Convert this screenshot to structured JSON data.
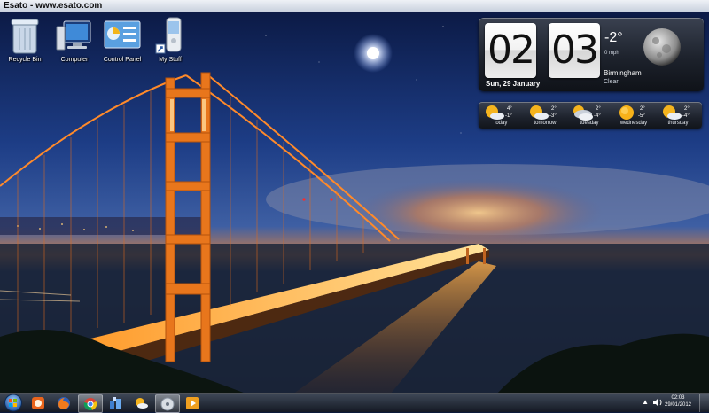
{
  "banner": {
    "text": "Esato - www.esato.com"
  },
  "desktop": {
    "icons": [
      {
        "label": "Recycle Bin",
        "icon": "recycle-bin-icon"
      },
      {
        "label": "Computer",
        "icon": "computer-icon"
      },
      {
        "label": "Control Panel",
        "icon": "control-panel-icon"
      },
      {
        "label": "My Stuff",
        "icon": "phone-shortcut-icon"
      }
    ]
  },
  "clock_gadget": {
    "hour": "02",
    "minute": "03",
    "date": "Sun, 29 January",
    "temperature": "-2°",
    "wind": "0 mph",
    "city": "Birmingham",
    "condition": "Clear"
  },
  "forecast": [
    {
      "day": "today",
      "high": "4°",
      "low": "-1°",
      "icon": "partly-sunny-icon"
    },
    {
      "day": "tomorrow",
      "high": "2°",
      "low": "-3°",
      "icon": "partly-sunny-icon"
    },
    {
      "day": "tuesday",
      "high": "2°",
      "low": "-4°",
      "icon": "cloudy-icon"
    },
    {
      "day": "wednesday",
      "high": "2°",
      "low": "-5°",
      "icon": "sunny-icon"
    },
    {
      "day": "thursday",
      "high": "2°",
      "low": "-4°",
      "icon": "partly-sunny-icon"
    }
  ],
  "taskbar": {
    "pinned": [
      {
        "name": "app-orange-icon"
      },
      {
        "name": "firefox-icon"
      },
      {
        "name": "chrome-icon"
      },
      {
        "name": "network-tool-icon"
      },
      {
        "name": "weather-app-icon"
      },
      {
        "name": "media-disc-icon"
      },
      {
        "name": "media-player-icon"
      }
    ],
    "tray": {
      "time": "02:03",
      "date": "29/01/2012"
    }
  },
  "colors": {
    "sky_top": "#0c1d4a",
    "bridge_orange": "#e8761c",
    "taskbar": "#1d2330"
  }
}
